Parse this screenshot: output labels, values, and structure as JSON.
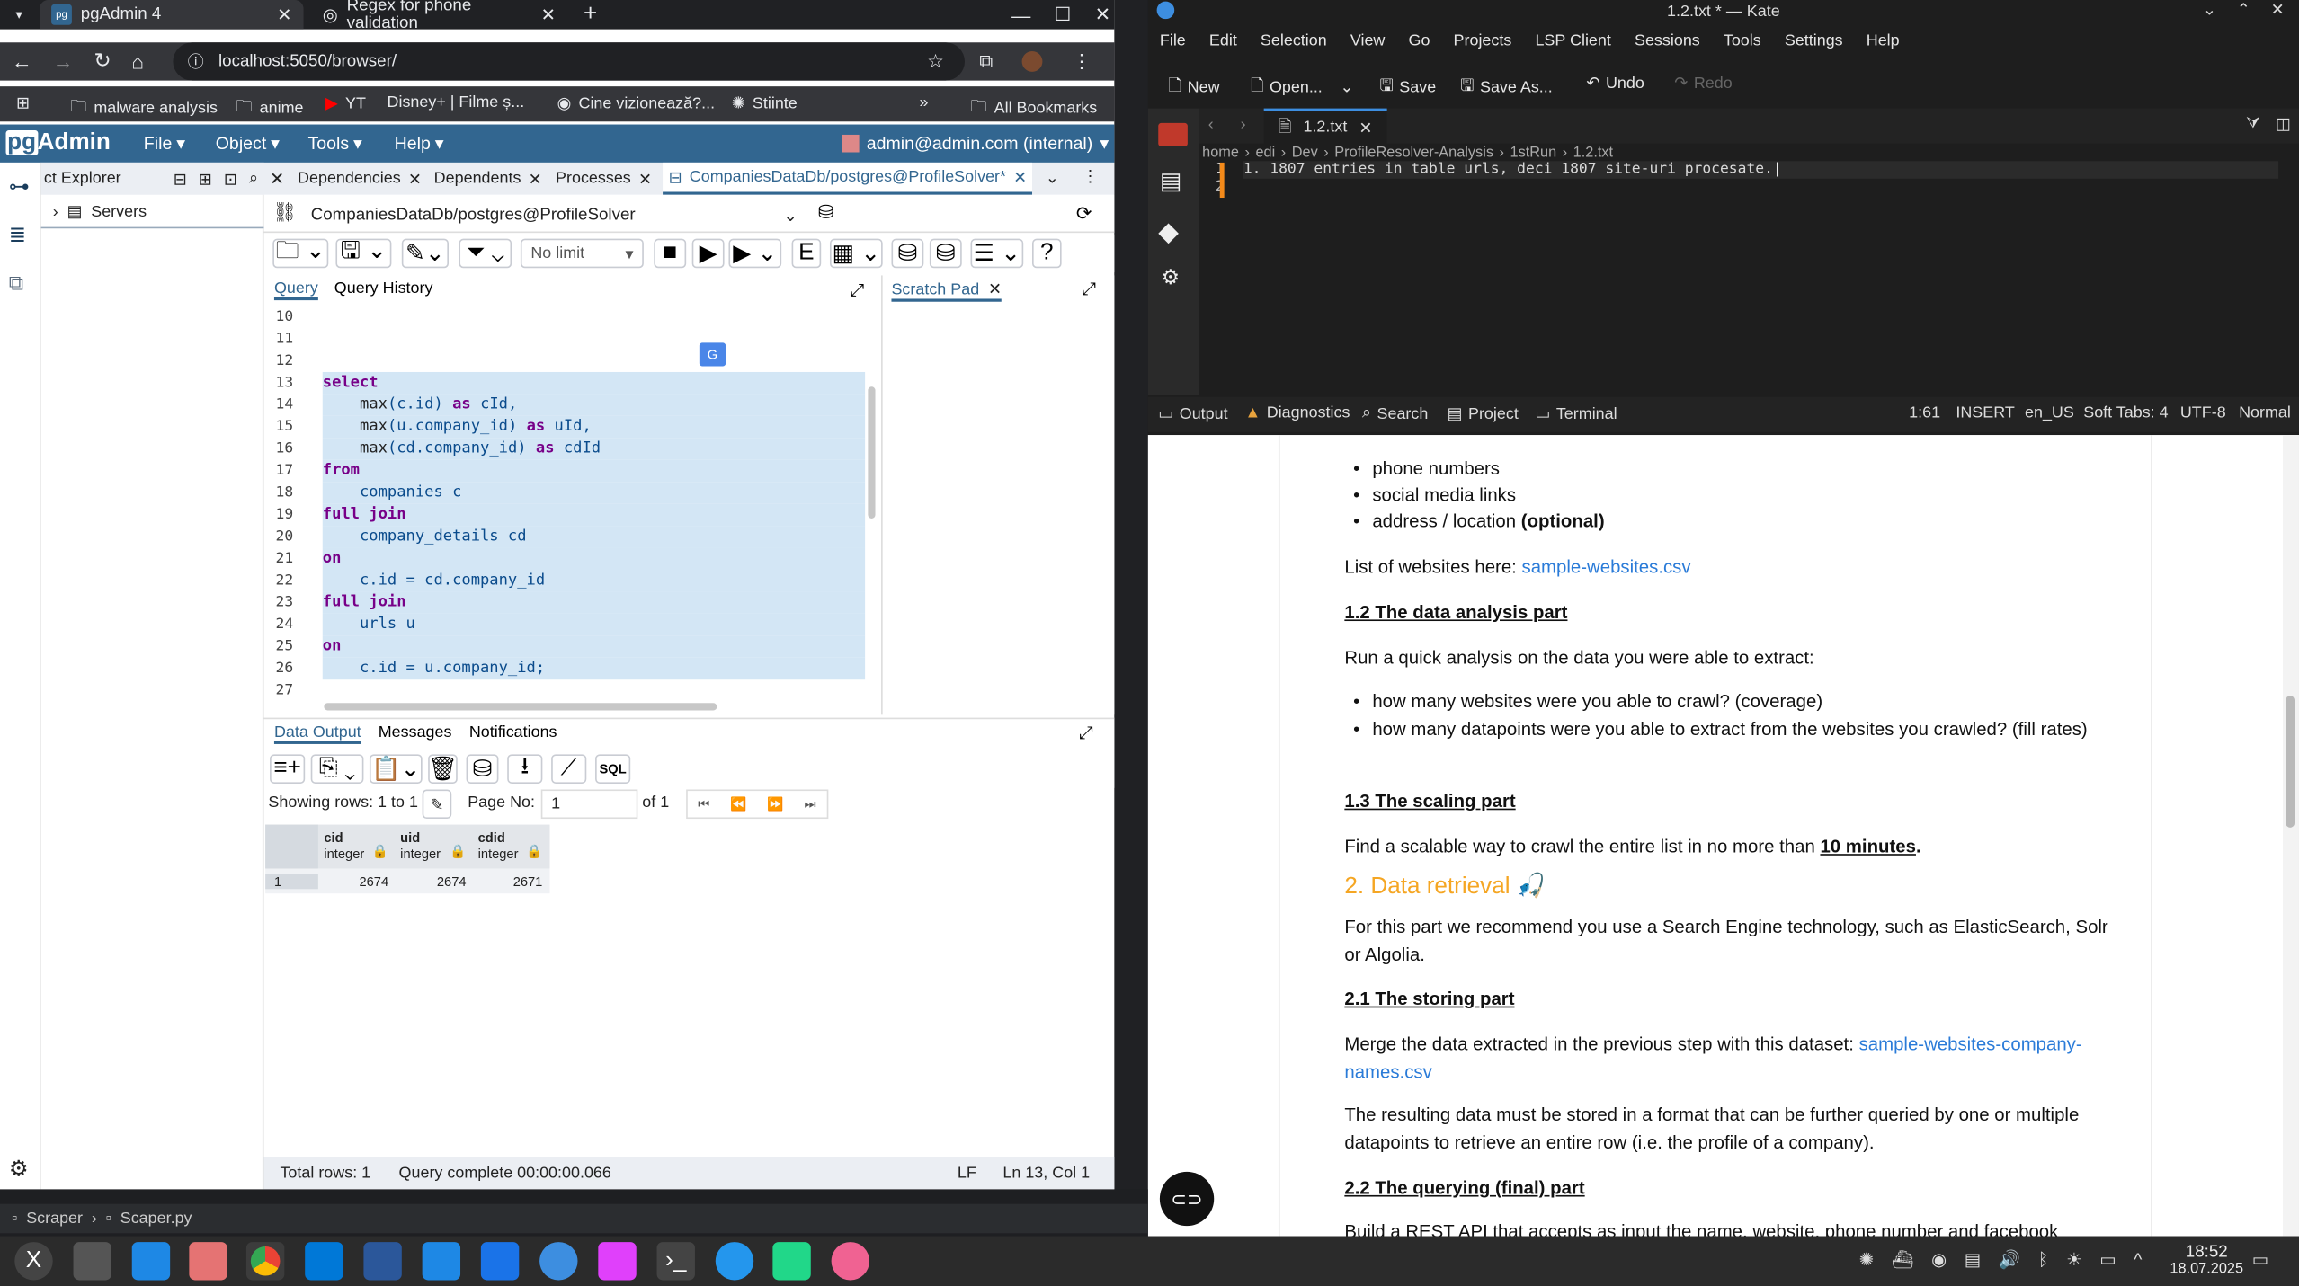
{
  "browser": {
    "tabs": [
      {
        "label": "pgAdmin 4",
        "active": true
      },
      {
        "label": "Regex for phone validation",
        "active": false
      }
    ],
    "url": "localhost:5050/browser/",
    "bookmarks": [
      "malware analysis",
      "anime",
      "YT",
      "Disney+ | Filme ș...",
      "Cine vizionează?...",
      "Stiinte"
    ],
    "all_bookmarks": "All Bookmarks"
  },
  "pgadmin": {
    "menus": [
      "File",
      "Object",
      "Tools",
      "Help"
    ],
    "user": "admin@admin.com (internal)",
    "explorer_tab": "ct Explorer",
    "servers": "Servers",
    "panel_tabs": [
      "Dependencies",
      "Dependents",
      "Processes",
      "CompaniesDataDb/postgres@ProfileSolver*"
    ],
    "connection": "CompaniesDataDb/postgres@ProfileSolver",
    "limit": "No limit",
    "editor_tabs": {
      "query": "Query",
      "history": "Query History",
      "scratch": "Scratch Pad"
    },
    "line_numbers": [
      "10",
      "11",
      "12",
      "13",
      "14",
      "15",
      "16",
      "17",
      "18",
      "19",
      "20",
      "21",
      "22",
      "23",
      "24",
      "25",
      "26",
      "27"
    ],
    "output_tabs": [
      "Data Output",
      "Messages",
      "Notifications"
    ],
    "pager": {
      "showing": "Showing rows: 1 to 1",
      "page_no": "Page No:",
      "page": "1",
      "of": "of 1"
    },
    "grid": {
      "columns": [
        {
          "name": "cid",
          "type": "integer"
        },
        {
          "name": "uid",
          "type": "integer"
        },
        {
          "name": "cdid",
          "type": "integer"
        }
      ],
      "rows": [
        {
          "n": "1",
          "values": [
            "2674",
            "2674",
            "2671"
          ]
        }
      ]
    },
    "status": {
      "total": "Total rows: 1",
      "complete": "Query complete 00:00:00.066",
      "eol": "LF",
      "pos": "Ln 13, Col 1"
    }
  },
  "kate": {
    "title": "1.2.txt * — Kate",
    "menus": [
      "File",
      "Edit",
      "Selection",
      "View",
      "Go",
      "Projects",
      "LSP Client",
      "Sessions",
      "Tools",
      "Settings",
      "Help"
    ],
    "toolbar": [
      "New",
      "Open...",
      "Save",
      "Save As...",
      "Undo",
      "Redo"
    ],
    "tab": "1.2.txt",
    "breadcrumbs": [
      "home",
      "edi",
      "Dev",
      "ProfileResolver-Analysis",
      "1stRun",
      "1.2.txt"
    ],
    "lines": [
      "1. 1807 entries in table urls, deci 1807 site-uri procesate.",
      ""
    ],
    "bottom_tabs": [
      "Output",
      "Diagnostics",
      "Search",
      "Project",
      "Terminal"
    ],
    "status": [
      "1:61",
      "INSERT",
      "en_US",
      "Soft Tabs: 4",
      "UTF-8",
      "Normal"
    ]
  },
  "doc": {
    "bullets1": [
      "phone numbers",
      "social media links"
    ],
    "bullet_address": "address / location ",
    "bullet_optional": "(optional)",
    "list_intro": "List of websites here: ",
    "list_link": "sample-websites.csv",
    "h12": "1.2 The data analysis part",
    "p12": "Run a quick analysis on the data you were able to extract:",
    "bullets2": [
      "how many websites were you able to crawl? (coverage)",
      "how many datapoints were you able to extract from the websites you crawled? (fill rates)"
    ],
    "h13": "1.3 The scaling part",
    "p13a": "Find a scalable way to crawl the entire list in no more than ",
    "p13b": "10 minutes",
    "p13c": ".",
    "h2": "2. Data retrieval 🎣",
    "p2": "For this part we recommend you use a Search Engine technology, such as ElasticSearch, Solr or Algolia.",
    "h21": "2.1 The storing part",
    "p21a": "Merge the data extracted in the previous step with this dataset: ",
    "p21link": "sample-websites-company-names.csv",
    "p21b": "The resulting data must be stored in a format that can be further queried by one or multiple datapoints to retrieve an entire row (i.e. the profile of a company).",
    "h22": "2.2 The querying (final) part",
    "p22": "Build a REST API that accepts as input the name, website, phone number and facebook"
  },
  "ide": {
    "breadcrumb": [
      "Scraper",
      "Scaper.py"
    ]
  },
  "taskbar": {
    "time": "18:52",
    "date": "18.07.2025"
  }
}
